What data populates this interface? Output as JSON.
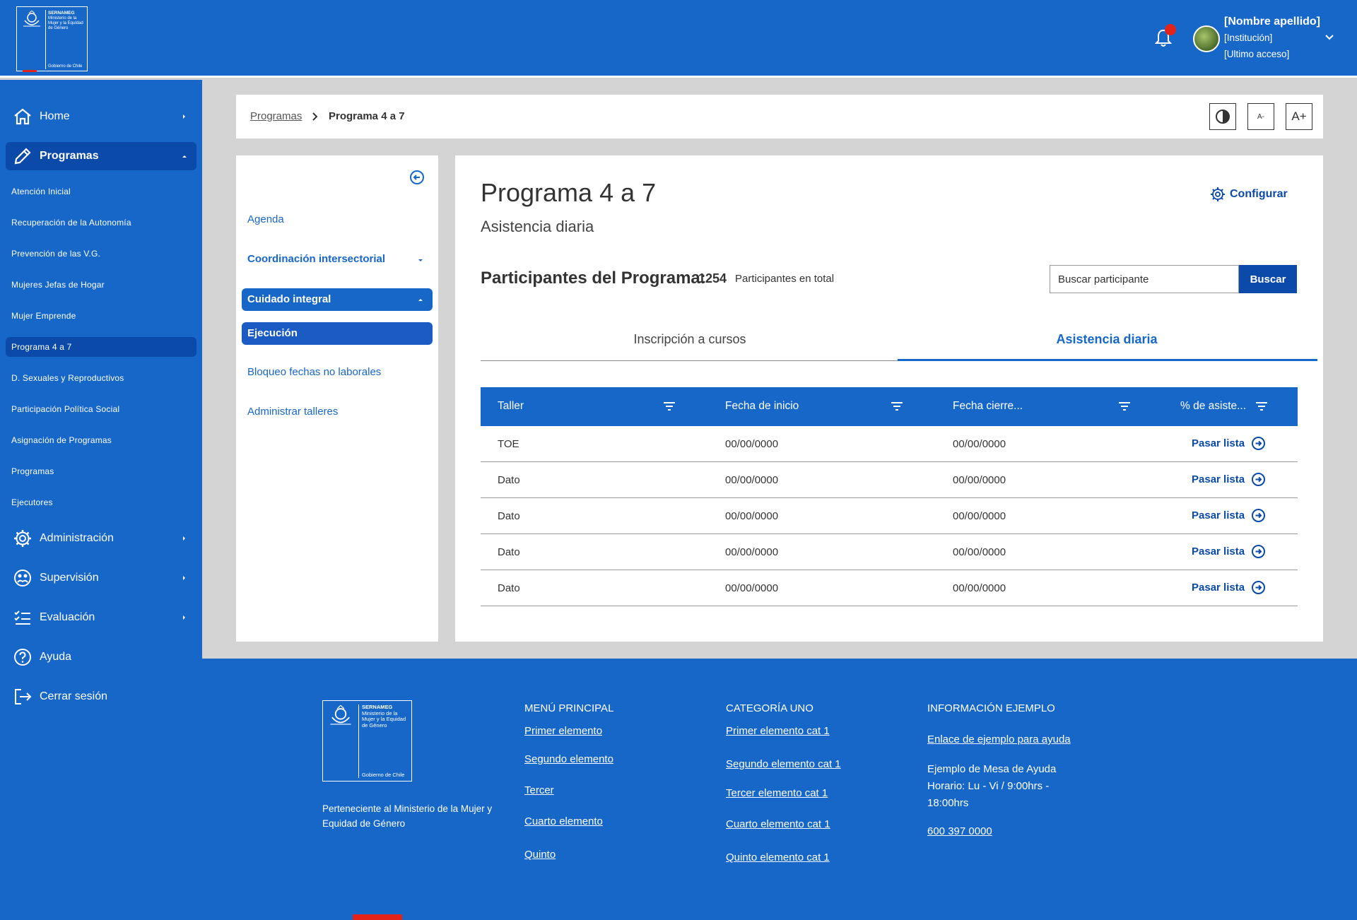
{
  "header": {
    "logo": {
      "org": "SERNAMEG",
      "ministry": "Ministerio de la Mujer y la Equidad de Género",
      "gov": "Gobierno de Chile"
    },
    "user": {
      "name": "[Nombre apellido]",
      "institution": "[Institución]",
      "last_access": "[Ultimo acceso]"
    }
  },
  "sidebar": {
    "home": "Home",
    "programas": "Programas",
    "sub_items": [
      "Atención Inicial",
      "Recuperación de la Autonomía",
      "Prevención de las V.G.",
      "Mujeres Jefas de Hogar",
      "Mujer Emprende",
      "Programa 4 a 7",
      "D. Sexuales y Reproductivos",
      "Participación Política Social",
      "Asignación de Programas",
      "Programas",
      "Ejecutores"
    ],
    "administracion": "Administración",
    "supervision": "Supervisión",
    "evaluacion": "Evaluación",
    "ayuda": "Ayuda",
    "cerrar": "Cerrar sesión"
  },
  "breadcrumb": {
    "parent": "Programas",
    "current": "Programa 4 a 7"
  },
  "toolbar": {
    "contrast_icon": "contrast-icon",
    "font_decrease": "A-",
    "font_increase": "A+"
  },
  "left_panel": {
    "agenda": "Agenda",
    "coordinacion": "Coordinación intersectorial",
    "cuidado": "Cuidado integral",
    "ejecucion": "Ejecución",
    "bloqueo": "Bloqueo fechas no laborales",
    "talleres": "Administrar talleres"
  },
  "main": {
    "title": "Programa 4 a 7",
    "subtitle": "Asistencia diaria",
    "configure": "Configurar",
    "participants_label": "Participantes del Programa:",
    "participants_count": "1254",
    "participants_suffix": "Participantes en total",
    "search_placeholder": "Buscar participante",
    "search_button": "Buscar",
    "tabs": [
      "Inscripción a cursos",
      "Asistencia diaria"
    ],
    "table": {
      "headers": [
        "Taller",
        "Fecha de inicio",
        "Fecha cierre...",
        "% de asiste..."
      ],
      "action_label": "Pasar lista",
      "rows": [
        [
          "TOE",
          "00/00/0000",
          "00/00/0000"
        ],
        [
          "Dato",
          "00/00/0000",
          "00/00/0000"
        ],
        [
          "Dato",
          "00/00/0000",
          "00/00/0000"
        ],
        [
          "Dato",
          "00/00/0000",
          "00/00/0000"
        ],
        [
          "Dato",
          "00/00/0000",
          "00/00/0000"
        ]
      ]
    }
  },
  "footer": {
    "logo": {
      "org": "SERNAMEG",
      "ministry": "Ministerio de la Mujer y la Equidad de Género",
      "gov": "Gobierno de Chile"
    },
    "text": "Perteneciente al Ministerio de la Mujer y Equidad de Género",
    "menu_title": "MENÚ PRINCIPAL",
    "menu_items": [
      "Primer elemento",
      "Segundo elemento",
      "Tercer",
      "Cuarto elemento",
      "Quinto"
    ],
    "cat_title": "CATEGORÍA UNO",
    "cat_items": [
      "Primer elemento cat 1",
      "Segundo elemento cat 1",
      "Tercer elemento cat 1",
      "Cuarto elemento cat 1",
      "Quinto elemento cat 1"
    ],
    "info_title": "INFORMACIÓN EJEMPLO",
    "info_link": "Enlace de ejemplo para ayuda",
    "info_text": "Ejemplo de Mesa de Ayuda Horario: Lu - Vi / 9:00hrs - 18:00hrs",
    "phone": "600 397 0000"
  },
  "colors": {
    "primary": "#1767c9",
    "dark": "#0b4aa8",
    "accent_red": "#e2231a"
  }
}
